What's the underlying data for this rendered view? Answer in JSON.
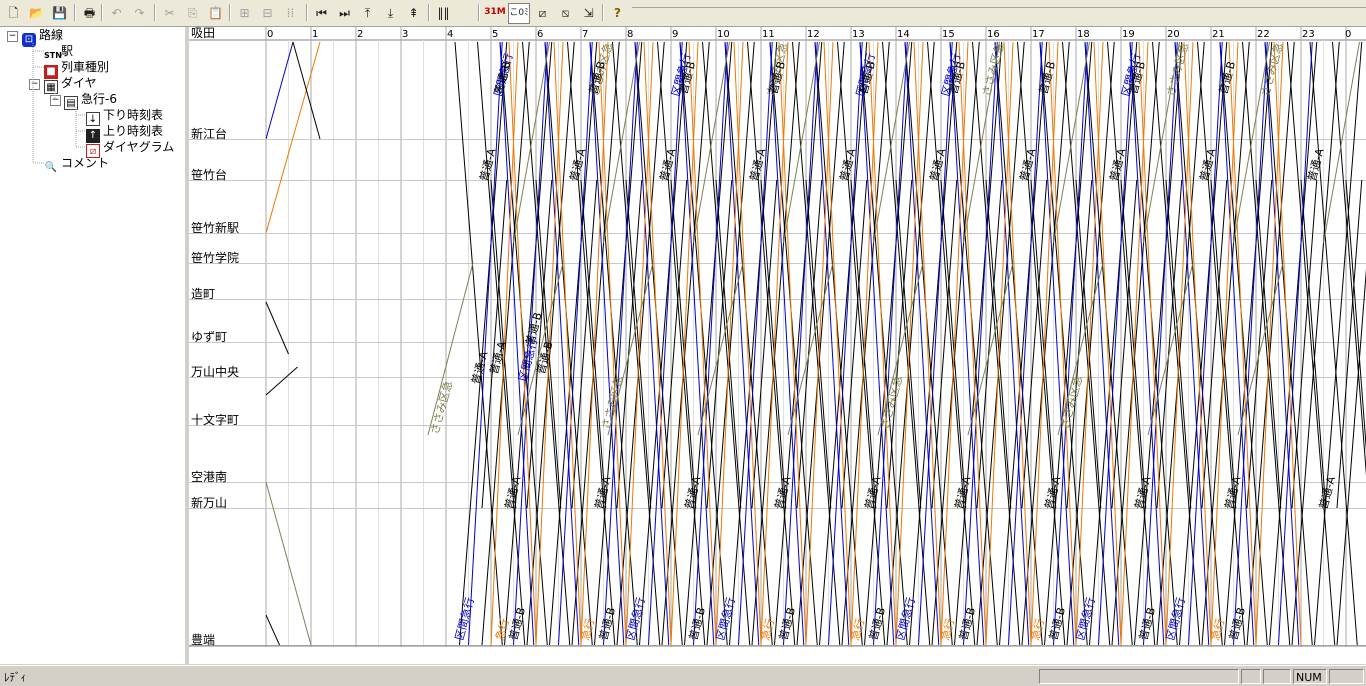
{
  "toolbar": {
    "buttons": [
      {
        "name": "new-file-icon",
        "glyph": "🗋"
      },
      {
        "name": "open-folder-icon",
        "glyph": "📂"
      },
      {
        "name": "save-icon",
        "glyph": "💾"
      },
      {
        "name": "print-icon",
        "glyph": "🖶"
      },
      {
        "name": "undo-icon",
        "glyph": "↶"
      },
      {
        "name": "redo-icon",
        "glyph": "↷"
      },
      {
        "name": "cut-icon",
        "glyph": "✂"
      },
      {
        "name": "copy-icon",
        "glyph": "⎘"
      },
      {
        "name": "paste-icon",
        "glyph": "📋"
      },
      {
        "name": "insert-train-icon",
        "glyph": "⊞"
      },
      {
        "name": "insert-train-right-icon",
        "glyph": "⊟"
      },
      {
        "name": "train-numbers-icon",
        "glyph": "⁞⁞"
      },
      {
        "name": "first-icon",
        "glyph": "⏮"
      },
      {
        "name": "last-icon",
        "glyph": "⏭"
      },
      {
        "name": "top-icon",
        "glyph": "⤒"
      },
      {
        "name": "bottom-icon",
        "glyph": "⤓"
      },
      {
        "name": "align-icon",
        "glyph": "⇞"
      },
      {
        "name": "vertical-lines-icon",
        "glyph": "‖‖"
      },
      {
        "name": "time-scale-icon",
        "glyph": "31M"
      },
      {
        "name": "train-name-icon",
        "glyph": "こ0ﾐ"
      },
      {
        "name": "diagram-lines-icon",
        "glyph": "⧄"
      },
      {
        "name": "diagram-lines-2-icon",
        "glyph": "⧅"
      },
      {
        "name": "diagram-shift-icon",
        "glyph": "⇲"
      },
      {
        "name": "help-icon",
        "glyph": "?"
      }
    ]
  },
  "tree": {
    "root": "路線",
    "station": "駅",
    "train_types": "列車種別",
    "dia": "ダイヤ",
    "dia_name": "急行-6",
    "down_table": "下り時刻表",
    "up_table": "上り時刻表",
    "diagram": "ダイヤグラム",
    "comment": "コメント"
  },
  "diagram": {
    "first_station": "吸田",
    "hours": [
      "0",
      "1",
      "2",
      "3",
      "4",
      "5",
      "6",
      "7",
      "8",
      "9",
      "10",
      "11",
      "12",
      "13",
      "14",
      "15",
      "16",
      "17",
      "18",
      "19",
      "20",
      "21",
      "22",
      "23",
      "0"
    ],
    "stations": [
      "新江台",
      "笹竹台",
      "笹竹新駅",
      "笹竹学院",
      "造町",
      "ゆず町",
      "万山中央",
      "十文字町",
      "空港南",
      "新万山",
      "豊端"
    ],
    "train_labels": {
      "local_a": "普通-A",
      "local_b": "普通-B",
      "section_express": "区間急行",
      "express": "急行",
      "sasami_express": "ささみ区急"
    },
    "colors": {
      "local": "#000000",
      "section_express": "#0000c8",
      "express": "#f07800",
      "sasami_express": "#808050",
      "grid": "#c0c0c0"
    }
  },
  "status": {
    "ready": "ﾚﾃﾞｨ",
    "num": "NUM"
  }
}
